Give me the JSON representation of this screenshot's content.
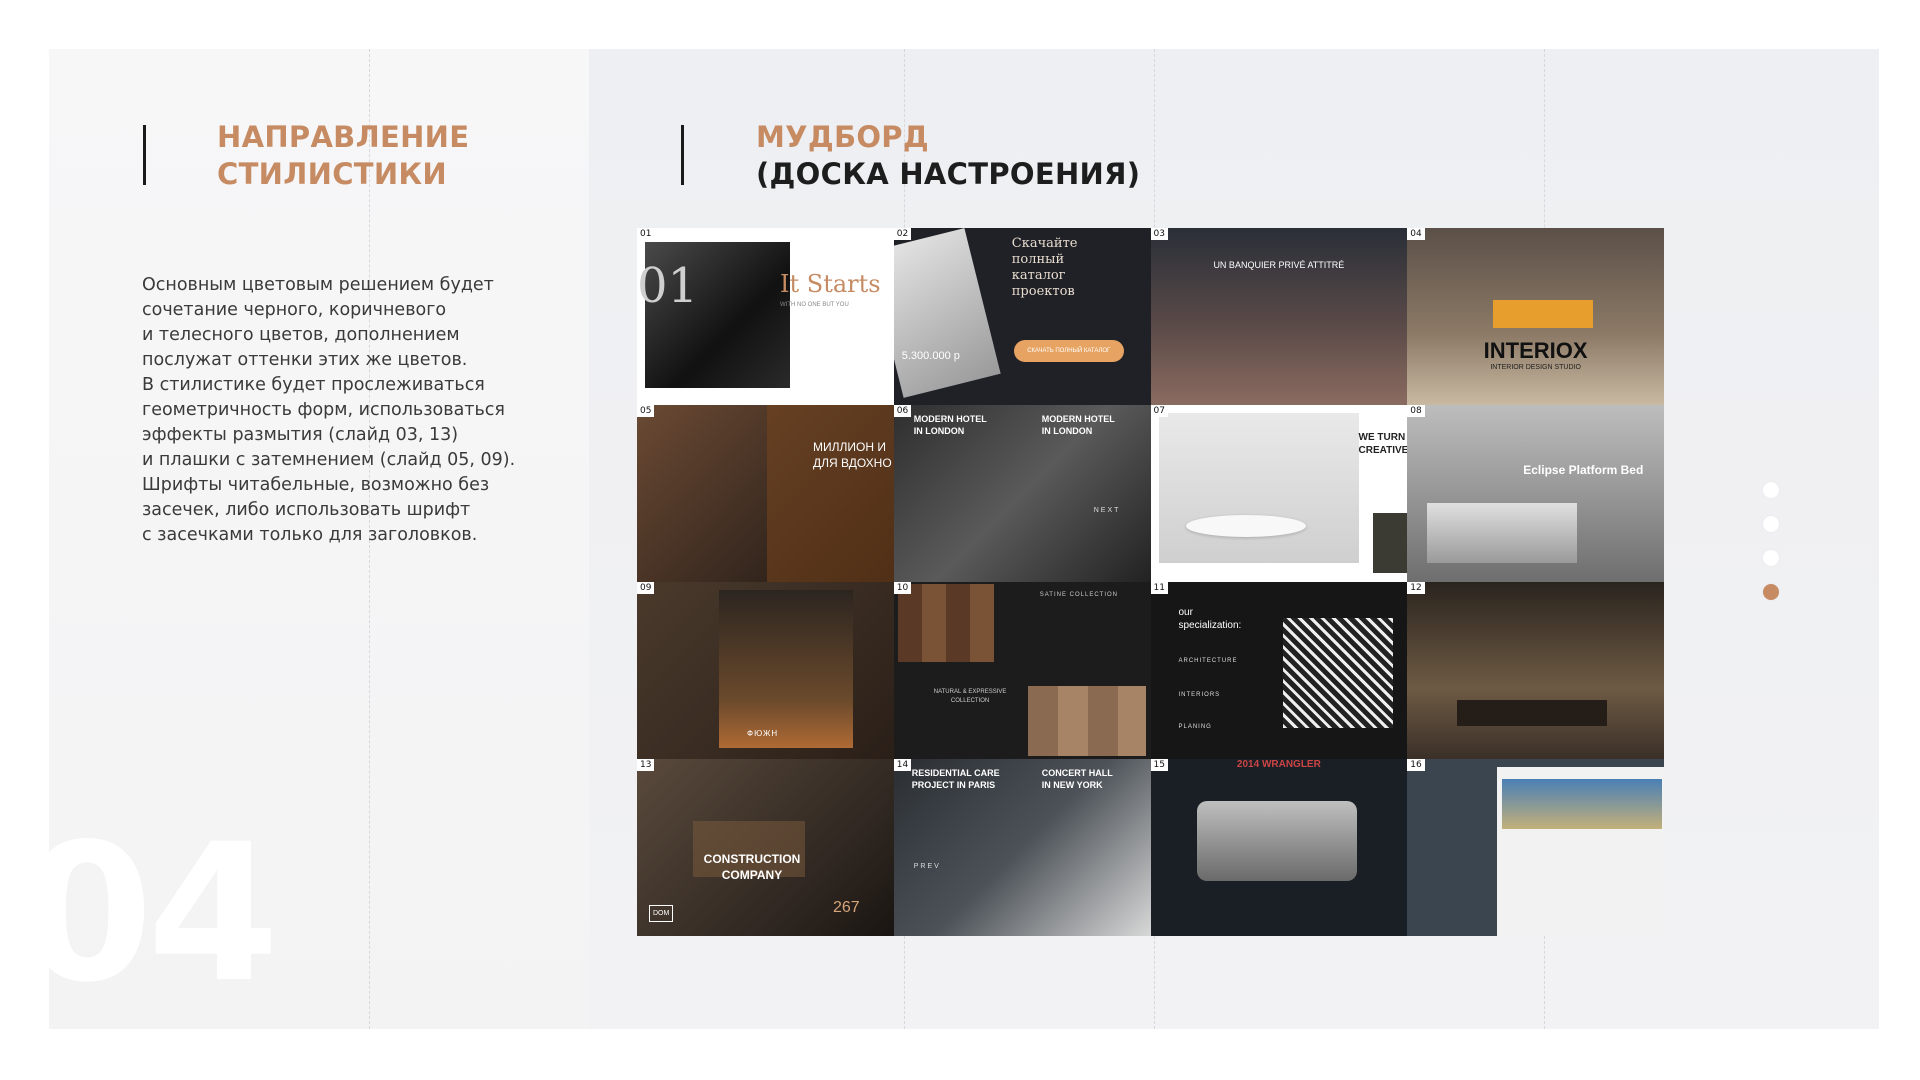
{
  "left": {
    "title_line1": "НАПРАВЛЕНИЕ",
    "title_line2": "СТИЛИСТИКИ",
    "description": "Основным цветовым решением будет\nсочетание черного, коричневого\nи телесного цветов, дополнением\nпослужат оттенки этих же цветов.\nВ стилистике будет прослеживаться\nгеометричность форм, использоваться\nэффекты размытия (слайд 03, 13)\nи плашки с затемнением (слайд 05, 09).\nШрифты читабельные, возможно без\nзасечек, либо использовать шрифт\nс засечками только для заголовков.",
    "slide_number": "04"
  },
  "right": {
    "title_line1": "МУДБОРД",
    "title_line2": "(ДОСКА НАСТРОЕНИЯ)"
  },
  "colors": {
    "accent": "#c68b62",
    "text_dark": "#1d1d1d"
  },
  "pagination": {
    "count": 4,
    "active_index": 3
  },
  "tiles": [
    {
      "num": "01",
      "caption": "It Starts",
      "sub": "WITH NO ONE BUT YOU",
      "big": "01"
    },
    {
      "num": "02",
      "caption": "Скачайте полный каталог проектов",
      "price": "5.300.000 р",
      "button": "СКАЧАТЬ ПОЛНЫЙ КАТАЛОГ"
    },
    {
      "num": "03",
      "caption": "UN BANQUIER PRIVÉ ATTITRÉ"
    },
    {
      "num": "04",
      "caption": "INTERIOX",
      "sub": "INTERIOR DESIGN STUDIO"
    },
    {
      "num": "05",
      "caption": "МИЛЛИОН И\nДЛЯ ВДОХНО"
    },
    {
      "num": "06",
      "caption": "MODERN HOTEL\nIN LONDON",
      "caption2": "MODERN HOTEL\nIN LONDON",
      "next": "NEXT"
    },
    {
      "num": "07",
      "caption": "WE TURN\nCREATIVE"
    },
    {
      "num": "08",
      "caption": "Eclipse Platform Bed"
    },
    {
      "num": "09",
      "caption": "ФЮЖН"
    },
    {
      "num": "10",
      "caption": "SATINE COLLECTION",
      "sub": "NATURAL & EXPRESSIVE\nCOLLECTION"
    },
    {
      "num": "11",
      "caption": "our\nspecialization:",
      "items": [
        "ARCHITECTURE",
        "INTERIORS",
        "PLANING"
      ]
    },
    {
      "num": "12"
    },
    {
      "num": "13",
      "caption": "CONSTRUCTION\nCOMPANY",
      "sub": "267",
      "logo": "DOM"
    },
    {
      "num": "14",
      "caption": "RESIDENTIAL CARE\nPROJECT IN PARIS",
      "caption2": "CONCERT HALL\nIN NEW YORK",
      "prev": "PREV"
    },
    {
      "num": "15",
      "caption": "2014 WRANGLER"
    },
    {
      "num": "16"
    }
  ]
}
